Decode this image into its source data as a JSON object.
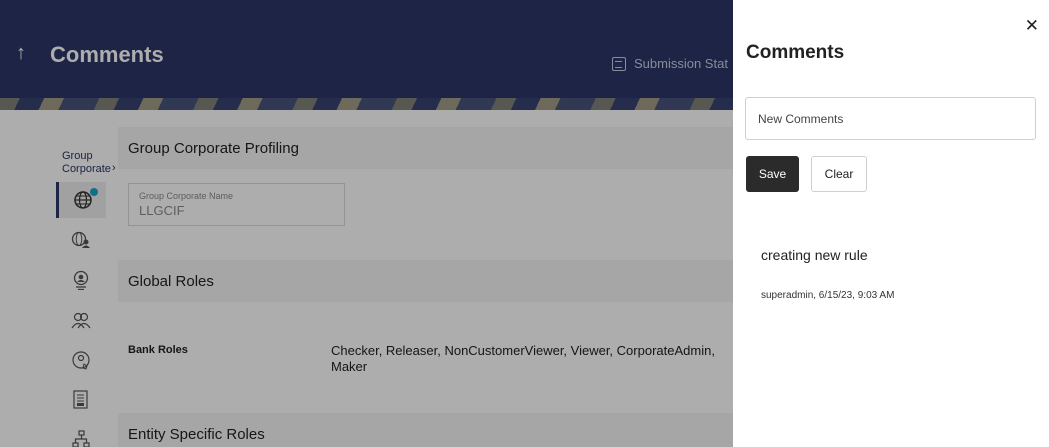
{
  "header": {
    "back_glyph": "↑",
    "title": "Comments",
    "submission_status": "Submission Stat"
  },
  "breadcrumb": {
    "label": "Group Corporate",
    "chevron": "›"
  },
  "sections": {
    "profiling": "Group Corporate Profiling",
    "global_roles": "Global Roles",
    "entity_roles": "Entity Specific Roles"
  },
  "group_corporate_field": {
    "label": "Group Corporate Name",
    "value": "LLGCIF"
  },
  "bank_roles": {
    "label": "Bank Roles",
    "value": "Checker, Releaser, NonCustomerViewer, Viewer, CorporateAdmin, Maker"
  },
  "side_icons": [
    "globe-icon",
    "globe-user-icon",
    "badge-icon",
    "users-icon",
    "user-shield-icon",
    "document-icon",
    "sitemap-icon"
  ],
  "comments_panel": {
    "close_glyph": "✕",
    "title": "Comments",
    "input_placeholder": "New Comments",
    "save_label": "Save",
    "clear_label": "Clear",
    "comments": [
      {
        "text": "creating new rule",
        "meta": "superadmin, 6/15/23, 9:03 AM"
      }
    ]
  },
  "colors": {
    "header_bg": "#2c3566",
    "accent_dot": "#1aa6c9",
    "save_button": "#2b2b2b"
  }
}
